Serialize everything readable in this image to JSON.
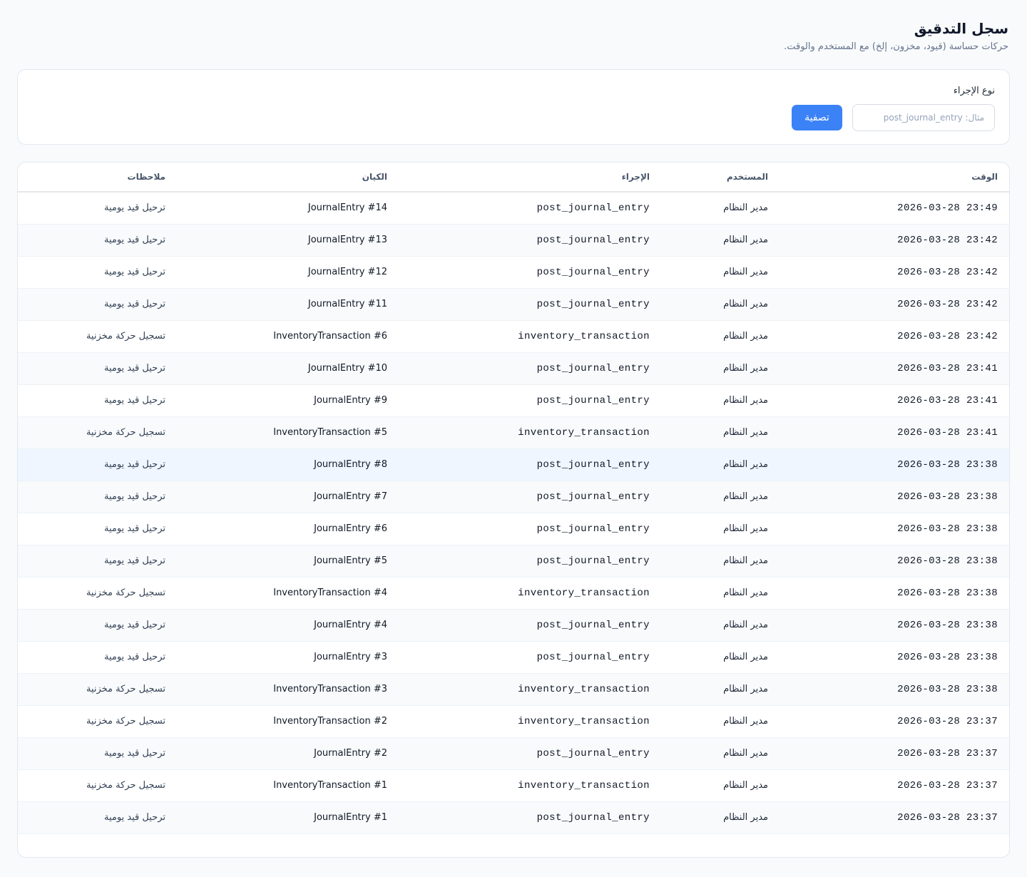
{
  "header": {
    "title": "سجل التدقيق",
    "subtitle": "حركات حساسة (قيود، مخزون، إلخ) مع المستخدم والوقت."
  },
  "filter": {
    "label": "نوع الإجراء",
    "placeholder": "مثال: post_journal_entry",
    "value": "",
    "button_label": "تصفية"
  },
  "table": {
    "columns": {
      "time": "الوقت",
      "user": "المستخدم",
      "action": "الإجراء",
      "entity": "الكيان",
      "notes": "ملاحظات"
    },
    "rows": [
      {
        "time": "2026-03-28 23:49",
        "user": "مدير النظام",
        "action": "post_journal_entry",
        "entity": "JournalEntry #14",
        "notes": "ترحيل قيد يومية"
      },
      {
        "time": "2026-03-28 23:42",
        "user": "مدير النظام",
        "action": "post_journal_entry",
        "entity": "JournalEntry #13",
        "notes": "ترحيل قيد يومية"
      },
      {
        "time": "2026-03-28 23:42",
        "user": "مدير النظام",
        "action": "post_journal_entry",
        "entity": "JournalEntry #12",
        "notes": "ترحيل قيد يومية"
      },
      {
        "time": "2026-03-28 23:42",
        "user": "مدير النظام",
        "action": "post_journal_entry",
        "entity": "JournalEntry #11",
        "notes": "ترحيل قيد يومية"
      },
      {
        "time": "2026-03-28 23:42",
        "user": "مدير النظام",
        "action": "inventory_transaction",
        "entity": "InventoryTransaction #6",
        "notes": "تسجيل حركة مخزنية"
      },
      {
        "time": "2026-03-28 23:41",
        "user": "مدير النظام",
        "action": "post_journal_entry",
        "entity": "JournalEntry #10",
        "notes": "ترحيل قيد يومية"
      },
      {
        "time": "2026-03-28 23:41",
        "user": "مدير النظام",
        "action": "post_journal_entry",
        "entity": "JournalEntry #9",
        "notes": "ترحيل قيد يومية"
      },
      {
        "time": "2026-03-28 23:41",
        "user": "مدير النظام",
        "action": "inventory_transaction",
        "entity": "InventoryTransaction #5",
        "notes": "تسجيل حركة مخزنية"
      },
      {
        "time": "2026-03-28 23:38",
        "user": "مدير النظام",
        "action": "post_journal_entry",
        "entity": "JournalEntry #8",
        "notes": "ترحيل قيد يومية"
      },
      {
        "time": "2026-03-28 23:38",
        "user": "مدير النظام",
        "action": "post_journal_entry",
        "entity": "JournalEntry #7",
        "notes": "ترحيل قيد يومية"
      },
      {
        "time": "2026-03-28 23:38",
        "user": "مدير النظام",
        "action": "post_journal_entry",
        "entity": "JournalEntry #6",
        "notes": "ترحيل قيد يومية"
      },
      {
        "time": "2026-03-28 23:38",
        "user": "مدير النظام",
        "action": "post_journal_entry",
        "entity": "JournalEntry #5",
        "notes": "ترحيل قيد يومية"
      },
      {
        "time": "2026-03-28 23:38",
        "user": "مدير النظام",
        "action": "inventory_transaction",
        "entity": "InventoryTransaction #4",
        "notes": "تسجيل حركة مخزنية"
      },
      {
        "time": "2026-03-28 23:38",
        "user": "مدير النظام",
        "action": "post_journal_entry",
        "entity": "JournalEntry #4",
        "notes": "ترحيل قيد يومية"
      },
      {
        "time": "2026-03-28 23:38",
        "user": "مدير النظام",
        "action": "post_journal_entry",
        "entity": "JournalEntry #3",
        "notes": "ترحيل قيد يومية"
      },
      {
        "time": "2026-03-28 23:38",
        "user": "مدير النظام",
        "action": "inventory_transaction",
        "entity": "InventoryTransaction #3",
        "notes": "تسجيل حركة مخزنية"
      },
      {
        "time": "2026-03-28 23:37",
        "user": "مدير النظام",
        "action": "inventory_transaction",
        "entity": "InventoryTransaction #2",
        "notes": "تسجيل حركة مخزنية"
      },
      {
        "time": "2026-03-28 23:37",
        "user": "مدير النظام",
        "action": "post_journal_entry",
        "entity": "JournalEntry #2",
        "notes": "ترحيل قيد يومية"
      },
      {
        "time": "2026-03-28 23:37",
        "user": "مدير النظام",
        "action": "inventory_transaction",
        "entity": "InventoryTransaction #1",
        "notes": "تسجيل حركة مخزنية"
      },
      {
        "time": "2026-03-28 23:37",
        "user": "مدير النظام",
        "action": "post_journal_entry",
        "entity": "JournalEntry #1",
        "notes": "ترحيل قيد يومية"
      }
    ]
  },
  "colors": {
    "accent": "#3b82f6",
    "background": "#f8fafc",
    "row_hover": "#eff6ff"
  }
}
